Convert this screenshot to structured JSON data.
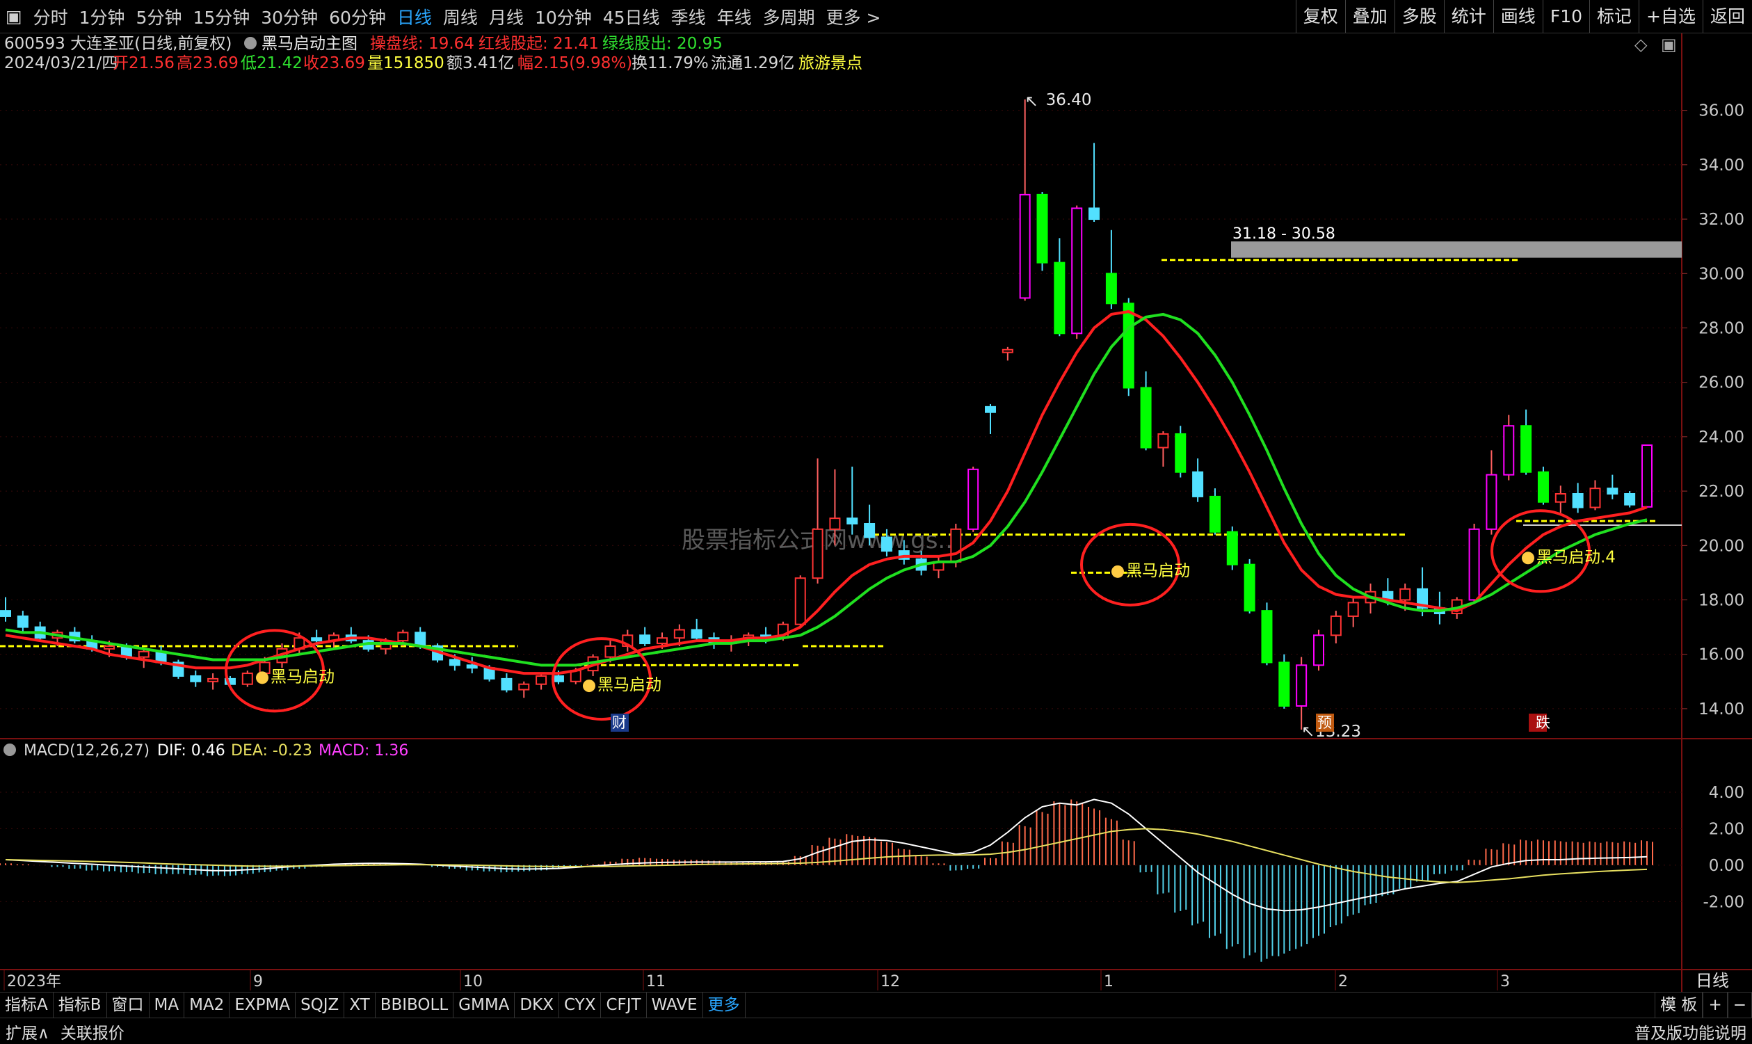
{
  "periods": [
    "分时",
    "1分钟",
    "5分钟",
    "15分钟",
    "30分钟",
    "60分钟",
    "日线",
    "周线",
    "月线",
    "10分钟",
    "45日线",
    "季线",
    "年线",
    "多周期",
    "更多 >"
  ],
  "active_period": "日线",
  "tools": [
    "复权",
    "叠加",
    "多股",
    "统计",
    "画线",
    "F10",
    "标记",
    "+自选",
    "返回"
  ],
  "header": {
    "code_name": "600593 大连圣亚(日线,前复权)",
    "indicator": "黑马启动主图",
    "cpx": "操盘线: 19.64",
    "red": "红线股起: 21.41",
    "green": "绿线股出: 20.95",
    "date": "2024/03/21/四",
    "open": "开21.56",
    "high": "高23.69",
    "low": "低21.42",
    "close": "收23.69",
    "volume": "量151850",
    "amount": "额3.41亿",
    "change": "幅2.15(9.98%)",
    "turnover": "换11.79%",
    "float": "流通1.29亿",
    "sector": "旅游景点"
  },
  "macd_header": {
    "name": "MACD(12,26,27)",
    "dif": "DIF: 0.46",
    "dea": "DEA: -0.23",
    "macd": "MACD: 1.36"
  },
  "annotations": {
    "high": "36.40",
    "low": "13.23",
    "zone": "31.18 - 30.58",
    "signal": "黑马启动",
    "signal_last": "黑马启动.4",
    "watermark": "股票指标公式网www.gs...",
    "marker_cai": "财",
    "marker_yu": "预",
    "marker_die": "跌"
  },
  "x_labels": [
    "2023年",
    "9",
    "10",
    "11",
    "12",
    "1",
    "2",
    "3"
  ],
  "bottom_tabs": [
    "指标A",
    "指标B",
    "窗口",
    "MA",
    "MA2",
    "EXPMA",
    "SQJZ",
    "XT",
    "BBIBOLL",
    "GMMA",
    "DKX",
    "CYX",
    "CFJT",
    "WAVE",
    "更多"
  ],
  "bottom_right": [
    "模 板",
    "+",
    "−"
  ],
  "right_label": "日线",
  "status": {
    "left": [
      "扩展∧",
      "关联报价"
    ],
    "right": "普及版功能说明"
  },
  "colors": {
    "up": "#ff00ff",
    "down": "#00ff00",
    "up_body": "#ff3333",
    "down_body": "#52e0ff",
    "red_line": "#ff2020",
    "green_line": "#20e020",
    "dash": "#ffff00",
    "white": "#ffffff",
    "dea": "#e8e060"
  },
  "chart_data": {
    "type": "candlestick",
    "price_axis": {
      "ticks": [
        36.0,
        34.0,
        32.0,
        30.0,
        28.0,
        26.0,
        24.0,
        22.0,
        20.0,
        18.0,
        16.0,
        14.0
      ],
      "range": [
        13.0,
        37.5
      ]
    },
    "candles_ohlc": [
      [
        17.6,
        18.1,
        17.2,
        17.4
      ],
      [
        17.4,
        17.6,
        16.8,
        17.0
      ],
      [
        17.0,
        17.2,
        16.5,
        16.6
      ],
      [
        16.6,
        16.9,
        16.3,
        16.8
      ],
      [
        16.8,
        17.0,
        16.4,
        16.5
      ],
      [
        16.5,
        16.7,
        16.1,
        16.2
      ],
      [
        16.2,
        16.5,
        15.9,
        16.3
      ],
      [
        16.3,
        16.4,
        15.8,
        15.9
      ],
      [
        15.9,
        16.2,
        15.5,
        16.1
      ],
      [
        16.1,
        16.3,
        15.6,
        15.7
      ],
      [
        15.7,
        15.8,
        15.1,
        15.2
      ],
      [
        15.2,
        15.4,
        14.8,
        15.0
      ],
      [
        15.0,
        15.3,
        14.7,
        15.1
      ],
      [
        15.1,
        15.2,
        14.8,
        14.9
      ],
      [
        14.9,
        15.4,
        14.8,
        15.3
      ],
      [
        15.3,
        15.9,
        15.1,
        15.7
      ],
      [
        15.7,
        16.4,
        15.5,
        16.2
      ],
      [
        16.2,
        16.8,
        16.0,
        16.6
      ],
      [
        16.6,
        16.9,
        16.3,
        16.5
      ],
      [
        16.5,
        16.8,
        16.2,
        16.7
      ],
      [
        16.7,
        17.0,
        16.4,
        16.5
      ],
      [
        16.5,
        16.7,
        16.1,
        16.2
      ],
      [
        16.2,
        16.6,
        16.0,
        16.5
      ],
      [
        16.5,
        16.9,
        16.3,
        16.8
      ],
      [
        16.8,
        17.0,
        16.2,
        16.3
      ],
      [
        16.3,
        16.4,
        15.7,
        15.8
      ],
      [
        15.8,
        16.0,
        15.4,
        15.6
      ],
      [
        15.6,
        15.9,
        15.3,
        15.5
      ],
      [
        15.5,
        15.6,
        15.0,
        15.1
      ],
      [
        15.1,
        15.3,
        14.6,
        14.7
      ],
      [
        14.7,
        15.0,
        14.4,
        14.9
      ],
      [
        14.9,
        15.3,
        14.7,
        15.2
      ],
      [
        15.2,
        15.4,
        14.9,
        15.0
      ],
      [
        15.0,
        15.5,
        14.9,
        15.4
      ],
      [
        15.4,
        16.0,
        15.2,
        15.9
      ],
      [
        15.9,
        16.5,
        15.7,
        16.3
      ],
      [
        16.3,
        16.9,
        16.1,
        16.7
      ],
      [
        16.7,
        17.0,
        16.3,
        16.4
      ],
      [
        16.4,
        16.8,
        16.2,
        16.6
      ],
      [
        16.6,
        17.1,
        16.3,
        16.9
      ],
      [
        16.9,
        17.3,
        16.5,
        16.6
      ],
      [
        16.6,
        16.8,
        16.2,
        16.4
      ],
      [
        16.4,
        16.7,
        16.1,
        16.5
      ],
      [
        16.5,
        16.8,
        16.3,
        16.7
      ],
      [
        16.7,
        17.0,
        16.4,
        16.6
      ],
      [
        16.6,
        17.2,
        16.5,
        17.1
      ],
      [
        17.1,
        18.9,
        17.0,
        18.8
      ],
      [
        18.8,
        23.2,
        18.6,
        20.6
      ],
      [
        20.6,
        22.8,
        20.0,
        21.0
      ],
      [
        21.0,
        22.9,
        20.4,
        20.8
      ],
      [
        20.8,
        21.5,
        20.0,
        20.3
      ],
      [
        20.3,
        20.6,
        19.6,
        19.8
      ],
      [
        19.8,
        20.2,
        19.3,
        19.5
      ],
      [
        19.5,
        19.8,
        18.9,
        19.1
      ],
      [
        19.1,
        19.6,
        18.8,
        19.4
      ],
      [
        19.4,
        20.8,
        19.2,
        20.6
      ],
      [
        20.6,
        22.9,
        20.5,
        22.8
      ],
      [
        25.1,
        25.2,
        24.1,
        24.9
      ],
      [
        27.1,
        27.3,
        26.8,
        27.2
      ],
      [
        29.1,
        36.4,
        29.0,
        32.9
      ],
      [
        32.9,
        33.0,
        30.1,
        30.4
      ],
      [
        30.4,
        31.3,
        27.7,
        27.8
      ],
      [
        27.8,
        32.5,
        27.6,
        32.4
      ],
      [
        32.4,
        34.8,
        31.9,
        32.0
      ],
      [
        30.0,
        31.6,
        28.7,
        28.9
      ],
      [
        28.9,
        29.1,
        25.5,
        25.8
      ],
      [
        25.8,
        26.4,
        23.5,
        23.6
      ],
      [
        23.6,
        24.2,
        22.9,
        24.1
      ],
      [
        24.1,
        24.4,
        22.5,
        22.7
      ],
      [
        22.7,
        23.2,
        21.6,
        21.8
      ],
      [
        21.8,
        22.1,
        20.4,
        20.5
      ],
      [
        20.5,
        20.7,
        19.1,
        19.3
      ],
      [
        19.3,
        19.5,
        17.5,
        17.6
      ],
      [
        17.6,
        17.9,
        15.6,
        15.7
      ],
      [
        15.7,
        16.0,
        14.0,
        14.1
      ],
      [
        14.1,
        15.9,
        13.23,
        15.6
      ],
      [
        15.6,
        16.9,
        15.4,
        16.7
      ],
      [
        16.7,
        17.6,
        16.4,
        17.4
      ],
      [
        17.4,
        18.1,
        17.0,
        17.9
      ],
      [
        17.9,
        18.6,
        17.5,
        18.3
      ],
      [
        18.3,
        18.8,
        17.8,
        18.0
      ],
      [
        18.0,
        18.6,
        17.6,
        18.4
      ],
      [
        18.4,
        19.2,
        17.4,
        17.7
      ],
      [
        17.7,
        18.3,
        17.1,
        17.5
      ],
      [
        17.5,
        18.1,
        17.3,
        18.0
      ],
      [
        18.0,
        20.8,
        17.9,
        20.6
      ],
      [
        20.6,
        23.5,
        20.4,
        22.6
      ],
      [
        22.6,
        24.8,
        22.4,
        24.4
      ],
      [
        24.4,
        25.0,
        22.6,
        22.7
      ],
      [
        22.7,
        22.9,
        21.5,
        21.6
      ],
      [
        21.6,
        22.2,
        21.2,
        21.9
      ],
      [
        21.9,
        22.3,
        21.2,
        21.4
      ],
      [
        21.4,
        22.4,
        21.3,
        22.1
      ],
      [
        22.1,
        22.6,
        21.7,
        21.9
      ],
      [
        21.9,
        22.0,
        21.4,
        21.5
      ],
      [
        21.42,
        23.69,
        21.42,
        23.69
      ]
    ],
    "red_line": [
      16.7,
      16.6,
      16.5,
      16.4,
      16.3,
      16.2,
      16.0,
      15.9,
      15.8,
      15.7,
      15.6,
      15.5,
      15.5,
      15.5,
      15.6,
      15.8,
      16.0,
      16.2,
      16.4,
      16.5,
      16.6,
      16.6,
      16.5,
      16.4,
      16.3,
      16.1,
      15.9,
      15.7,
      15.5,
      15.4,
      15.3,
      15.3,
      15.3,
      15.4,
      15.6,
      15.8,
      16.0,
      16.2,
      16.3,
      16.4,
      16.5,
      16.5,
      16.5,
      16.6,
      16.6,
      16.7,
      17.0,
      17.6,
      18.3,
      18.9,
      19.3,
      19.5,
      19.6,
      19.6,
      19.6,
      19.7,
      20.1,
      20.9,
      22.0,
      23.4,
      24.8,
      26.0,
      27.1,
      28.0,
      28.5,
      28.6,
      28.3,
      27.7,
      26.9,
      26.0,
      25.0,
      23.9,
      22.7,
      21.4,
      20.1,
      19.1,
      18.5,
      18.2,
      18.1,
      18.1,
      18.0,
      17.9,
      17.8,
      17.7,
      17.6,
      17.9,
      18.6,
      19.3,
      19.9,
      20.4,
      20.7,
      20.9,
      21.0,
      21.1,
      21.2,
      21.41
    ],
    "green_line": [
      16.9,
      16.8,
      16.8,
      16.7,
      16.6,
      16.5,
      16.4,
      16.3,
      16.2,
      16.1,
      16.0,
      15.9,
      15.8,
      15.8,
      15.8,
      15.8,
      15.9,
      16.0,
      16.1,
      16.2,
      16.3,
      16.4,
      16.4,
      16.4,
      16.3,
      16.2,
      16.1,
      16.0,
      15.9,
      15.8,
      15.7,
      15.6,
      15.6,
      15.6,
      15.7,
      15.8,
      15.9,
      16.0,
      16.1,
      16.2,
      16.3,
      16.4,
      16.4,
      16.5,
      16.5,
      16.6,
      16.7,
      17.0,
      17.4,
      17.9,
      18.4,
      18.8,
      19.1,
      19.3,
      19.4,
      19.4,
      19.6,
      20.0,
      20.7,
      21.6,
      22.7,
      23.9,
      25.1,
      26.3,
      27.3,
      28.0,
      28.4,
      28.5,
      28.3,
      27.8,
      27.0,
      26.0,
      24.8,
      23.5,
      22.1,
      20.8,
      19.7,
      18.9,
      18.4,
      18.1,
      17.9,
      17.7,
      17.6,
      17.6,
      17.7,
      17.9,
      18.2,
      18.6,
      19.0,
      19.4,
      19.8,
      20.1,
      20.4,
      20.6,
      20.8,
      20.95
    ],
    "support_zone": {
      "top": 31.18,
      "bottom": 30.58
    },
    "macd_axis": {
      "ticks": [
        4.0,
        2.0,
        0.0,
        -2.0
      ],
      "range": [
        -5.5,
        4.8
      ]
    },
    "macd_hist": [
      0.1,
      0.05,
      0.0,
      -0.1,
      -0.2,
      -0.3,
      -0.35,
      -0.4,
      -0.45,
      -0.5,
      -0.5,
      -0.55,
      -0.6,
      -0.6,
      -0.5,
      -0.4,
      -0.3,
      -0.2,
      -0.1,
      0.0,
      0.05,
      0.1,
      0.1,
      0.05,
      0.0,
      -0.1,
      -0.2,
      -0.3,
      -0.35,
      -0.4,
      -0.35,
      -0.3,
      -0.2,
      -0.1,
      0.05,
      0.2,
      0.35,
      0.4,
      0.35,
      0.3,
      0.3,
      0.25,
      0.2,
      0.2,
      0.15,
      0.2,
      0.5,
      1.1,
      1.5,
      1.7,
      1.6,
      1.3,
      0.9,
      0.5,
      0.1,
      -0.3,
      -0.2,
      0.4,
      1.3,
      2.2,
      3.0,
      3.5,
      3.6,
      3.2,
      2.6,
      1.4,
      -0.4,
      -1.6,
      -2.6,
      -3.3,
      -4.0,
      -4.6,
      -5.1,
      -5.3,
      -5.0,
      -4.6,
      -4.0,
      -3.4,
      -2.8,
      -2.2,
      -1.7,
      -1.3,
      -0.9,
      -0.5,
      -0.3,
      0.3,
      0.9,
      1.2,
      1.4,
      1.4,
      1.35,
      1.3,
      1.3,
      1.3,
      1.3,
      1.36
    ],
    "dif": [
      0.3,
      0.25,
      0.2,
      0.15,
      0.1,
      0.05,
      0.0,
      -0.05,
      -0.1,
      -0.15,
      -0.2,
      -0.25,
      -0.3,
      -0.3,
      -0.25,
      -0.2,
      -0.12,
      -0.05,
      0.0,
      0.05,
      0.08,
      0.1,
      0.1,
      0.08,
      0.05,
      0.0,
      -0.05,
      -0.1,
      -0.15,
      -0.2,
      -0.22,
      -0.2,
      -0.18,
      -0.12,
      -0.05,
      0.02,
      0.08,
      0.12,
      0.15,
      0.16,
      0.17,
      0.17,
      0.17,
      0.18,
      0.18,
      0.2,
      0.35,
      0.7,
      1.0,
      1.3,
      1.4,
      1.35,
      1.2,
      1.0,
      0.8,
      0.6,
      0.7,
      1.1,
      1.8,
      2.6,
      3.2,
      3.4,
      3.3,
      3.6,
      3.4,
      2.8,
      2.0,
      1.2,
      0.4,
      -0.4,
      -1.0,
      -1.6,
      -2.1,
      -2.4,
      -2.5,
      -2.45,
      -2.3,
      -2.1,
      -1.9,
      -1.7,
      -1.5,
      -1.3,
      -1.15,
      -1.0,
      -0.9,
      -0.5,
      -0.1,
      0.1,
      0.25,
      0.3,
      0.3,
      0.35,
      0.38,
      0.4,
      0.42,
      0.46
    ],
    "dea": [
      0.3,
      0.28,
      0.26,
      0.24,
      0.22,
      0.2,
      0.18,
      0.15,
      0.12,
      0.08,
      0.05,
      0.02,
      0.0,
      -0.03,
      -0.05,
      -0.06,
      -0.06,
      -0.05,
      -0.04,
      -0.03,
      -0.02,
      0.0,
      0.01,
      0.02,
      0.02,
      0.02,
      0.01,
      0.0,
      -0.02,
      -0.04,
      -0.06,
      -0.07,
      -0.08,
      -0.08,
      -0.08,
      -0.07,
      -0.05,
      -0.03,
      -0.01,
      0.01,
      0.03,
      0.05,
      0.06,
      0.07,
      0.08,
      0.09,
      0.11,
      0.15,
      0.22,
      0.3,
      0.38,
      0.45,
      0.5,
      0.53,
      0.55,
      0.55,
      0.56,
      0.6,
      0.7,
      0.85,
      1.05,
      1.25,
      1.45,
      1.65,
      1.85,
      1.95,
      2.0,
      1.95,
      1.85,
      1.7,
      1.5,
      1.3,
      1.05,
      0.8,
      0.55,
      0.3,
      0.05,
      -0.15,
      -0.35,
      -0.5,
      -0.65,
      -0.75,
      -0.85,
      -0.92,
      -0.95,
      -0.9,
      -0.82,
      -0.75,
      -0.65,
      -0.55,
      -0.48,
      -0.42,
      -0.36,
      -0.31,
      -0.27,
      -0.23
    ]
  }
}
